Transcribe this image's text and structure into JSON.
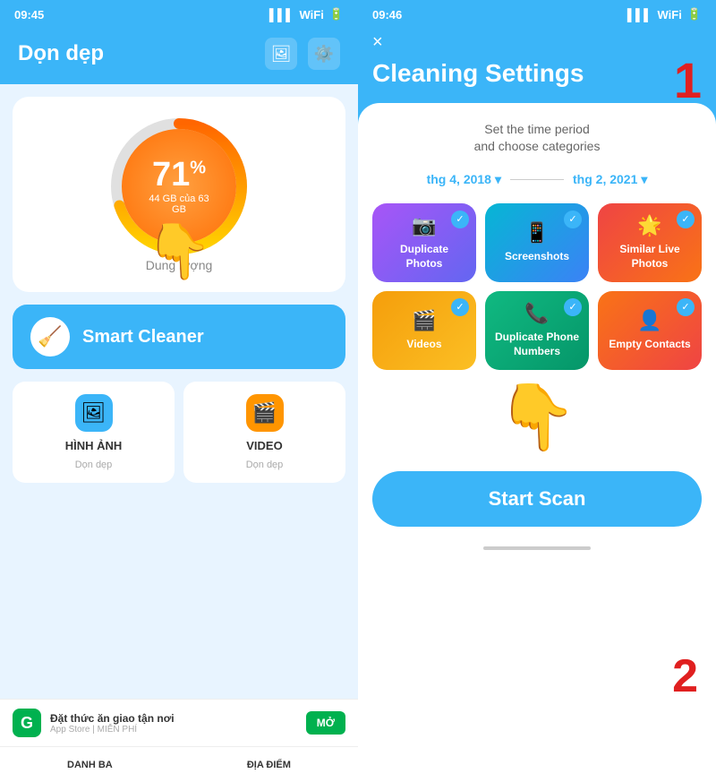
{
  "left": {
    "status_time": "09:45",
    "title": "Dọn dẹp",
    "storage": {
      "percent": "71",
      "percent_unit": "%",
      "used_gb": "44 GB",
      "of_text": "của",
      "total_gb": "63 GB",
      "label": "Dung lượng"
    },
    "smart_cleaner": "Smart Cleaner",
    "grid_items": [
      {
        "title": "HÌNH ẢNH",
        "subtitle": "Dọn dẹp"
      },
      {
        "title": "VIDEO",
        "subtitle": "Dọn dẹp"
      }
    ],
    "ad": {
      "logo": "G",
      "title": "Đặt thức ăn giao tận nơi",
      "subtitle": "App Store | MIỄN PHÍ",
      "button": "MỞ"
    },
    "bottom_tabs": [
      {
        "label": "DANH BA"
      },
      {
        "label": "ĐỊA ĐIỂM"
      }
    ]
  },
  "right": {
    "status_time": "09:46",
    "title": "Cleaning Settings",
    "close_icon": "×",
    "subtitle": "Set the time period\nand choose categories",
    "step1": "1",
    "step2": "2",
    "date_from": "thg 4, 2018",
    "date_to": "thg 2, 2021",
    "categories": [
      {
        "label": "Duplicate Photos",
        "style": "cat-purple",
        "checked": true
      },
      {
        "label": "Screenshots",
        "style": "cat-cyan",
        "checked": true
      },
      {
        "label": "Similar Live Photos",
        "style": "cat-red",
        "checked": true
      },
      {
        "label": "Videos",
        "style": "cat-yellow",
        "checked": true
      },
      {
        "label": "Duplicate Phone Numbers",
        "style": "cat-teal",
        "checked": true
      },
      {
        "label": "Empty Contacts",
        "style": "cat-orange",
        "checked": true
      }
    ],
    "start_scan": "Start Scan"
  }
}
